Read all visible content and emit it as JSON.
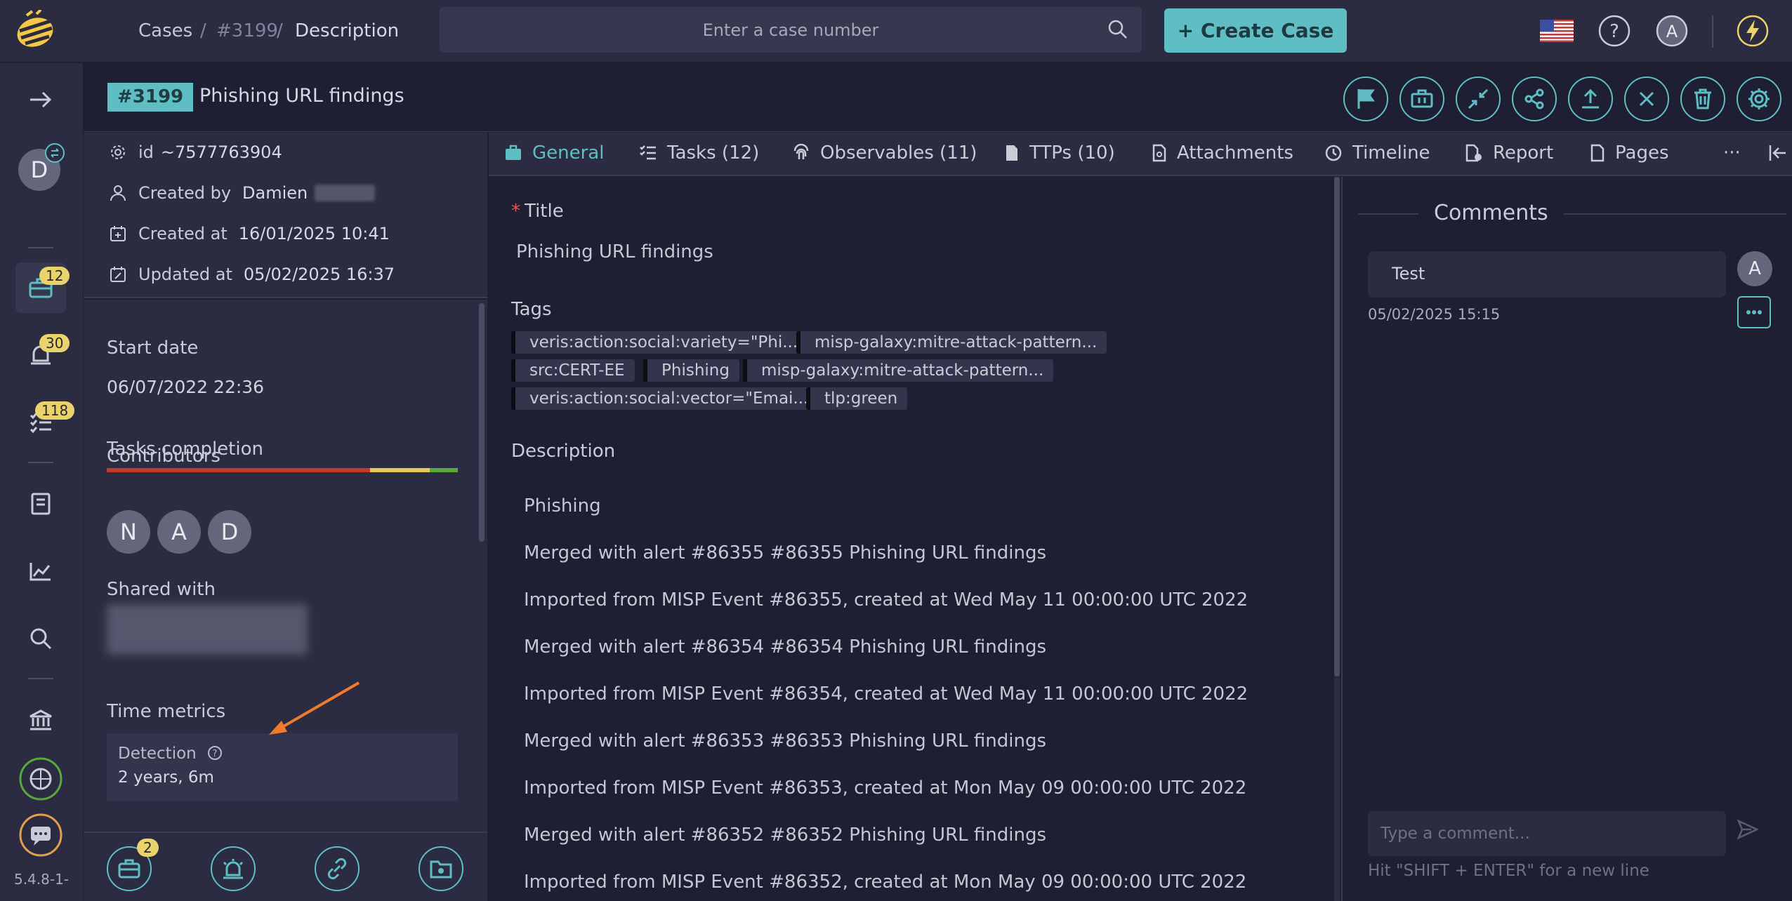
{
  "breadcrumb": {
    "cases": "Cases",
    "sep": "/",
    "case_id": "#3199",
    "page": "Description"
  },
  "search": {
    "placeholder": "Enter a case number"
  },
  "create_case": {
    "label": "+ Create Case"
  },
  "nav": {
    "badges": {
      "cases": "12",
      "alerts": "30",
      "tasks": "118"
    },
    "user_initial": "D",
    "version": "5.4.8-1-"
  },
  "top_user_initial": "A",
  "case": {
    "number": "#3199",
    "title": "Phishing URL findings"
  },
  "meta": {
    "id_label": "id",
    "id_value": "~7577763904",
    "created_by_label": "Created by",
    "created_by_value": "Damien",
    "created_at_label": "Created at",
    "created_at_value": "16/01/2025 10:41",
    "updated_at_label": "Updated at",
    "updated_at_value": "05/02/2025 16:37"
  },
  "details": {
    "start_date_label": "Start date",
    "start_date_value": "06/07/2022 22:36",
    "tasks_completion_label": "Tasks completion",
    "tasks_completion": {
      "red": 0.75,
      "yellow": 0.17,
      "green": 0.08
    },
    "contributors_label": "Contributors",
    "contributors": [
      "N",
      "A",
      "D"
    ],
    "shared_with_label": "Shared with",
    "time_metrics_label": "Time metrics",
    "detection_label": "Detection",
    "detection_value": "2 years, 6m"
  },
  "bottom_badge": "2",
  "tabs": [
    {
      "label": "General"
    },
    {
      "label": "Tasks (12)"
    },
    {
      "label": "Observables (11)"
    },
    {
      "label": "TTPs (10)"
    },
    {
      "label": "Attachments"
    },
    {
      "label": "Timeline"
    },
    {
      "label": "Report"
    },
    {
      "label": "Pages"
    },
    {
      "label": "···"
    }
  ],
  "general": {
    "title_label": "Title",
    "required_mark": "*",
    "title_value": "Phishing URL findings",
    "tags_label": "Tags",
    "tags": [
      "veris:action:social:variety=\"Phi...",
      "misp-galaxy:mitre-attack-pattern...",
      "src:CERT-EE",
      "Phishing",
      "misp-galaxy:mitre-attack-pattern...",
      "veris:action:social:vector=\"Emai...",
      "tlp:green"
    ],
    "description_label": "Description",
    "description": [
      "Phishing",
      "Merged with alert #86355 #86355 Phishing URL findings",
      "Imported from MISP Event #86355, created at Wed May 11 00:00:00 UTC 2022",
      "Merged with alert #86354 #86354 Phishing URL findings",
      "Imported from MISP Event #86354, created at Wed May 11 00:00:00 UTC 2022",
      "Merged with alert #86353 #86353 Phishing URL findings",
      "Imported from MISP Event #86353, created at Mon May 09 00:00:00 UTC 2022",
      "Merged with alert #86352 #86352 Phishing URL findings",
      "Imported from MISP Event #86352, created at Mon May 09 00:00:00 UTC 2022"
    ]
  },
  "comments": {
    "title": "Comments",
    "items": [
      {
        "text": "Test",
        "time": "05/02/2025 15:15",
        "author_initial": "A"
      }
    ],
    "input_placeholder": "Type a comment...",
    "hint": "Hit \"SHIFT + ENTER\" for a new line"
  },
  "colors": {
    "accent": "#5fbec4",
    "badge": "#e9d36a",
    "progress_red": "#c0392b",
    "progress_yellow": "#e3c85a",
    "progress_green": "#5aa83c",
    "annotation_arrow": "#f07b2b"
  }
}
